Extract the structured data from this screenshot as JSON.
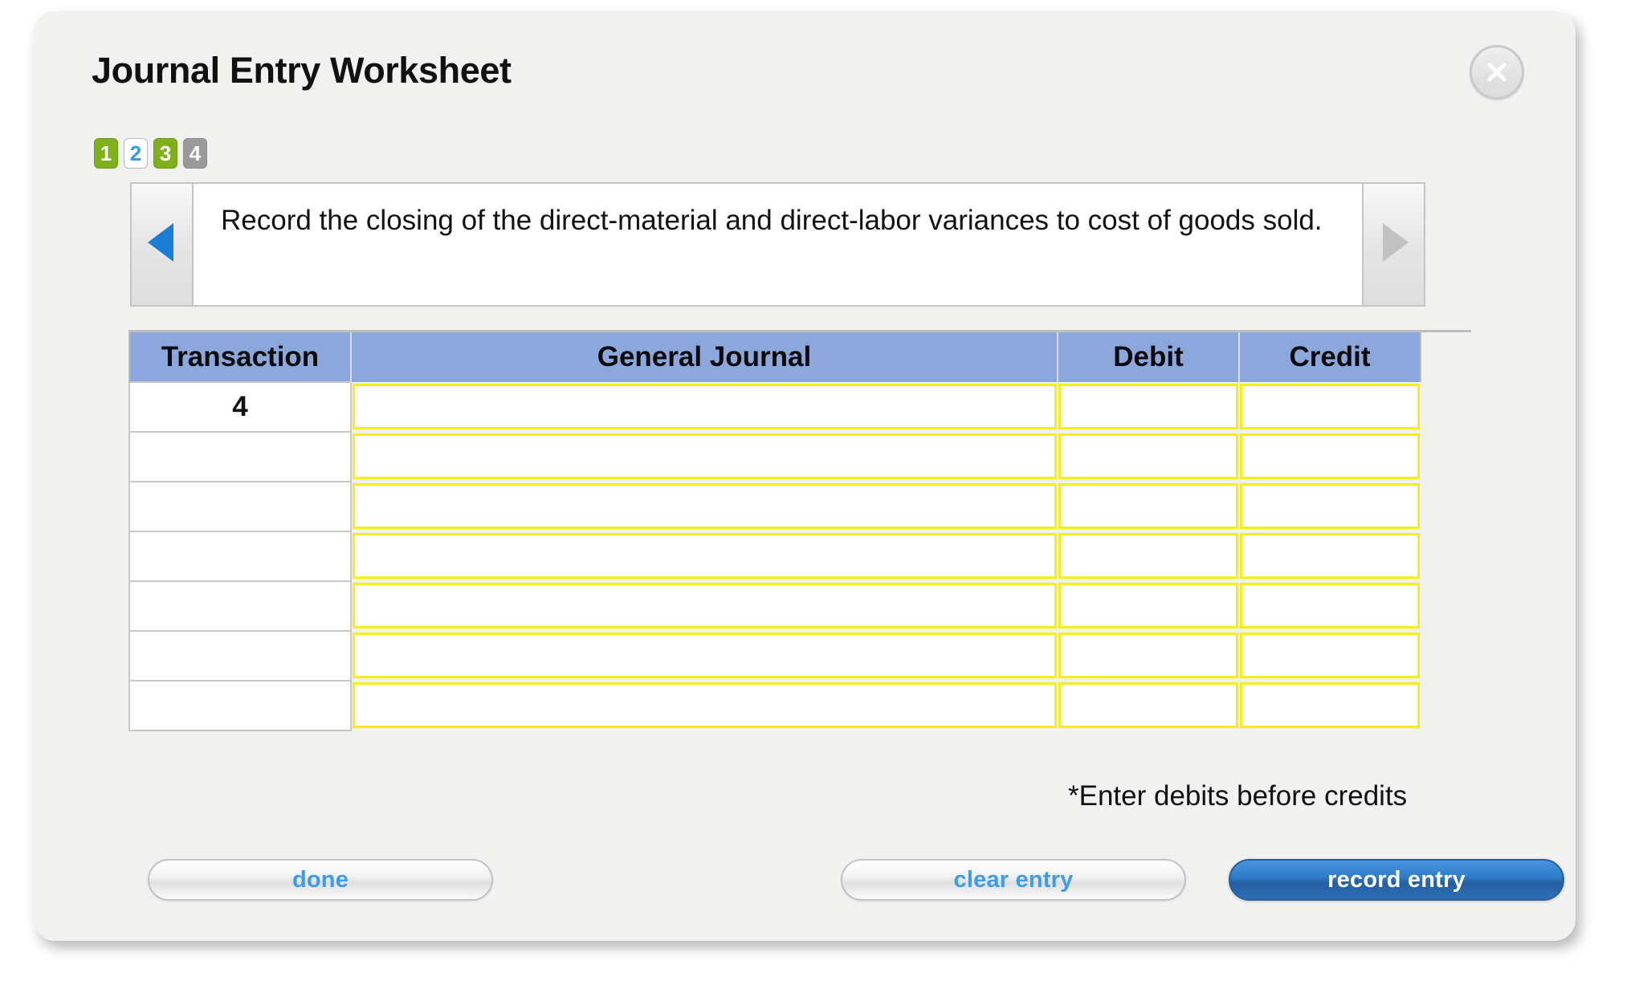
{
  "dialog": {
    "title": "Journal Entry Worksheet",
    "close_label": "X",
    "close_icon": "close-icon"
  },
  "steps": [
    {
      "label": "1",
      "state": "done"
    },
    {
      "label": "2",
      "state": "current"
    },
    {
      "label": "3",
      "state": "done"
    },
    {
      "label": "4",
      "state": "todo"
    }
  ],
  "navigation": {
    "prev_icon": "triangle-left-icon",
    "next_icon": "triangle-right-icon",
    "prev_enabled": true,
    "next_enabled": false,
    "prev_color": "#1a7fd4",
    "next_color": "#c2c2c2"
  },
  "instruction": {
    "text": "Record the closing of the direct-material and direct-labor variances to cost of goods sold."
  },
  "table": {
    "headers": [
      "Transaction",
      "General Journal",
      "Debit",
      "Credit"
    ],
    "header_bg": "#8ba7db",
    "input_border": "#f6ef13",
    "rows": [
      {
        "transaction": "4",
        "general_journal": "",
        "debit": "",
        "credit": ""
      },
      {
        "transaction": "",
        "general_journal": "",
        "debit": "",
        "credit": ""
      },
      {
        "transaction": "",
        "general_journal": "",
        "debit": "",
        "credit": ""
      },
      {
        "transaction": "",
        "general_journal": "",
        "debit": "",
        "credit": ""
      },
      {
        "transaction": "",
        "general_journal": "",
        "debit": "",
        "credit": ""
      },
      {
        "transaction": "",
        "general_journal": "",
        "debit": "",
        "credit": ""
      },
      {
        "transaction": "",
        "general_journal": "",
        "debit": "",
        "credit": ""
      }
    ]
  },
  "footnote": "*Enter debits before credits",
  "buttons": {
    "done": "done",
    "clear_entry": "clear entry",
    "record_entry": "record entry",
    "primary_color": "#2f7ccb",
    "link_color": "#3d9bf0"
  }
}
